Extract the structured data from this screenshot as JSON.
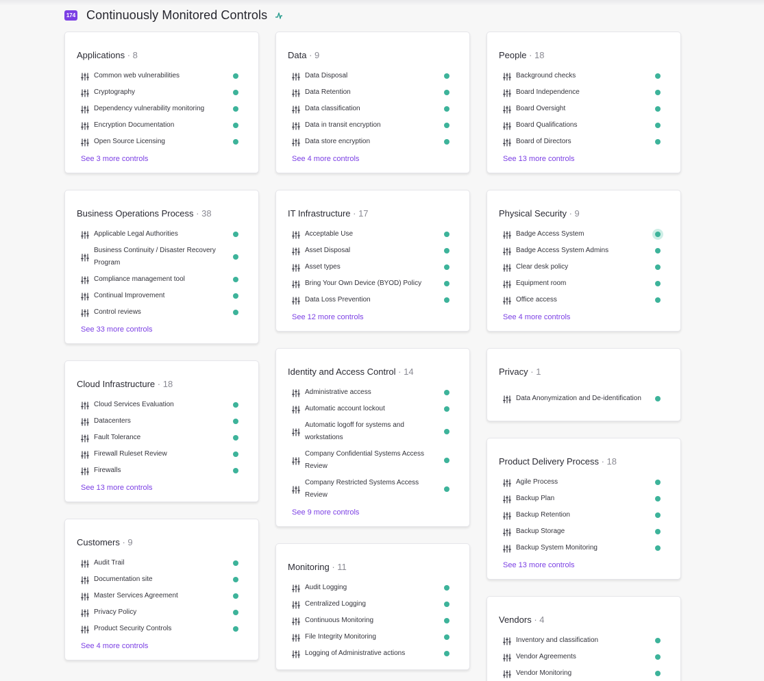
{
  "header": {
    "count": "174",
    "title": "Continuously Monitored Controls"
  },
  "columns": [
    [
      {
        "title": "Applications",
        "count": "· 8",
        "items": [
          "Common web vulnerabilities",
          "Cryptography",
          "Dependency vulnerability monitoring",
          "Encryption Documentation",
          "Open Source Licensing"
        ],
        "more": "See 3 more controls"
      },
      {
        "title": "Business Operations Process",
        "count": "· 38",
        "items": [
          "Applicable Legal Authorities",
          "Business Continuity / Disaster Recovery Program",
          "Compliance management tool",
          "Continual Improvement",
          "Control reviews"
        ],
        "more": "See 33 more controls"
      },
      {
        "title": "Cloud Infrastructure",
        "count": "· 18",
        "items": [
          "Cloud Services Evaluation",
          "Datacenters",
          "Fault Tolerance",
          "Firewall Ruleset Review",
          "Firewalls"
        ],
        "more": "See 13 more controls"
      },
      {
        "title": "Customers",
        "count": "· 9",
        "items": [
          "Audit Trail",
          "Documentation site",
          "Master Services Agreement",
          "Privacy Policy",
          "Product Security Controls"
        ],
        "more": "See 4 more controls"
      }
    ],
    [
      {
        "title": "Data",
        "count": "· 9",
        "items": [
          "Data Disposal",
          "Data Retention",
          "Data classification",
          "Data in transit encryption",
          "Data store encryption"
        ],
        "more": "See 4 more controls"
      },
      {
        "title": "IT Infrastructure",
        "count": "· 17",
        "items": [
          "Acceptable Use",
          "Asset Disposal",
          "Asset types",
          "Bring Your Own Device (BYOD) Policy",
          "Data Loss Prevention"
        ],
        "more": "See 12 more controls"
      },
      {
        "title": "Identity and Access Control",
        "count": "· 14",
        "items": [
          "Administrative access",
          "Automatic account lockout",
          "Automatic logoff for systems and workstations",
          "Company Confidential Systems Access Review",
          "Company Restricted Systems Access Review"
        ],
        "more": "See 9 more controls"
      },
      {
        "title": "Monitoring",
        "count": "· 11",
        "items": [
          "Audit Logging",
          "Centralized Logging",
          "Continuous Monitoring",
          "File Integrity Monitoring",
          "Logging of Administrative actions"
        ],
        "more": ""
      }
    ],
    [
      {
        "title": "People",
        "count": "· 18",
        "items": [
          "Background checks",
          "Board Independence",
          "Board Oversight",
          "Board Qualifications",
          "Board of Directors"
        ],
        "more": "See 13 more controls"
      },
      {
        "title": "Physical Security",
        "count": "· 9",
        "items": [
          "Badge Access System",
          "Badge Access System Admins",
          "Clear desk policy",
          "Equipment room",
          "Office access"
        ],
        "more": "See 4 more controls"
      },
      {
        "title": "Privacy",
        "count": "· 1",
        "items": [
          "Data Anonymization and De-identification"
        ],
        "more": ""
      },
      {
        "title": "Product Delivery Process",
        "count": "· 18",
        "items": [
          "Agile Process",
          "Backup Plan",
          "Backup Retention",
          "Backup Storage",
          "Backup System Monitoring"
        ],
        "more": "See 13 more controls"
      },
      {
        "title": "Vendors",
        "count": "· 4",
        "items": [
          "Inventory and classification",
          "Vendor Agreements",
          "Vendor Monitoring"
        ],
        "more": ""
      }
    ]
  ],
  "icons": {
    "control": "sliders-icon",
    "status": "status-dot-green",
    "header": "pulse-icon"
  },
  "colors": {
    "accent": "#7b3fe4",
    "status": "#3db39a"
  }
}
